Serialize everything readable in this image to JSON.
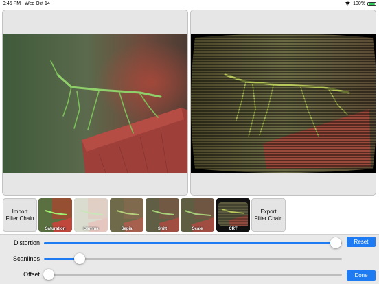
{
  "status_bar": {
    "time": "9:45 PM",
    "date": "Wed Oct 14",
    "battery_percent": "100%",
    "battery_level": 1.0,
    "wifi_icon": "wifi-icon",
    "battery_icon": "battery-charging-icon"
  },
  "panels": {
    "original": "photo-praying-mantis",
    "filtered": "photo-praying-mantis-crt-filter"
  },
  "filter_strip": {
    "import_label": "Import\nFilter Chain",
    "export_label": "Export\nFilter Chain",
    "filters": [
      {
        "label": "Saturation"
      },
      {
        "label": "Gamma"
      },
      {
        "label": "Sepia"
      },
      {
        "label": "Shift"
      },
      {
        "label": "Scale"
      },
      {
        "label": "CRT"
      }
    ]
  },
  "controls": {
    "sliders": [
      {
        "label": "Distortion",
        "value": 0.98
      },
      {
        "label": "Scanlines",
        "value": 0.12
      },
      {
        "label": "Offset",
        "value": 0.0
      }
    ],
    "reset_label": "Reset",
    "done_label": "Done"
  },
  "colors": {
    "accent": "#1f7bf2",
    "battery_green": "#34c759"
  }
}
